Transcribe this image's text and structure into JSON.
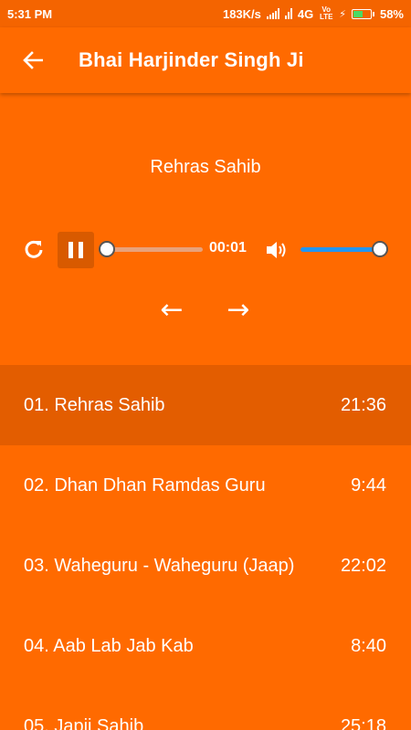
{
  "status_bar": {
    "time": "5:31 PM",
    "speed": "183K/s",
    "network": "4G",
    "volte": "Vo LTE",
    "battery": "58%",
    "battery_level": 0.58
  },
  "app_bar": {
    "title": "Bhai Harjinder Singh Ji",
    "back_icon": "arrow-back-icon"
  },
  "player": {
    "now_playing": "Rehras Sahib",
    "elapsed": "00:01",
    "seek_progress": 0.0,
    "volume_level": 1.0,
    "icons": {
      "replay": "replay-icon",
      "pause": "pause-icon",
      "volume": "volume-icon"
    },
    "prev_label": "←",
    "next_label": "→"
  },
  "colors": {
    "background": "#ff6a00",
    "active_row": "#e35d00",
    "volume_accent": "#2196f3"
  },
  "tracks": [
    {
      "title": "01. Rehras Sahib",
      "duration": "21:36"
    },
    {
      "title": "02. Dhan Dhan Ramdas Guru",
      "duration": "9:44"
    },
    {
      "title": "03. Waheguru - Waheguru (Jaap)",
      "duration": "22:02"
    },
    {
      "title": "04. Aab Lab Jab Kab",
      "duration": "8:40"
    },
    {
      "title": "05. Japji Sahib",
      "duration": "25:18"
    }
  ]
}
